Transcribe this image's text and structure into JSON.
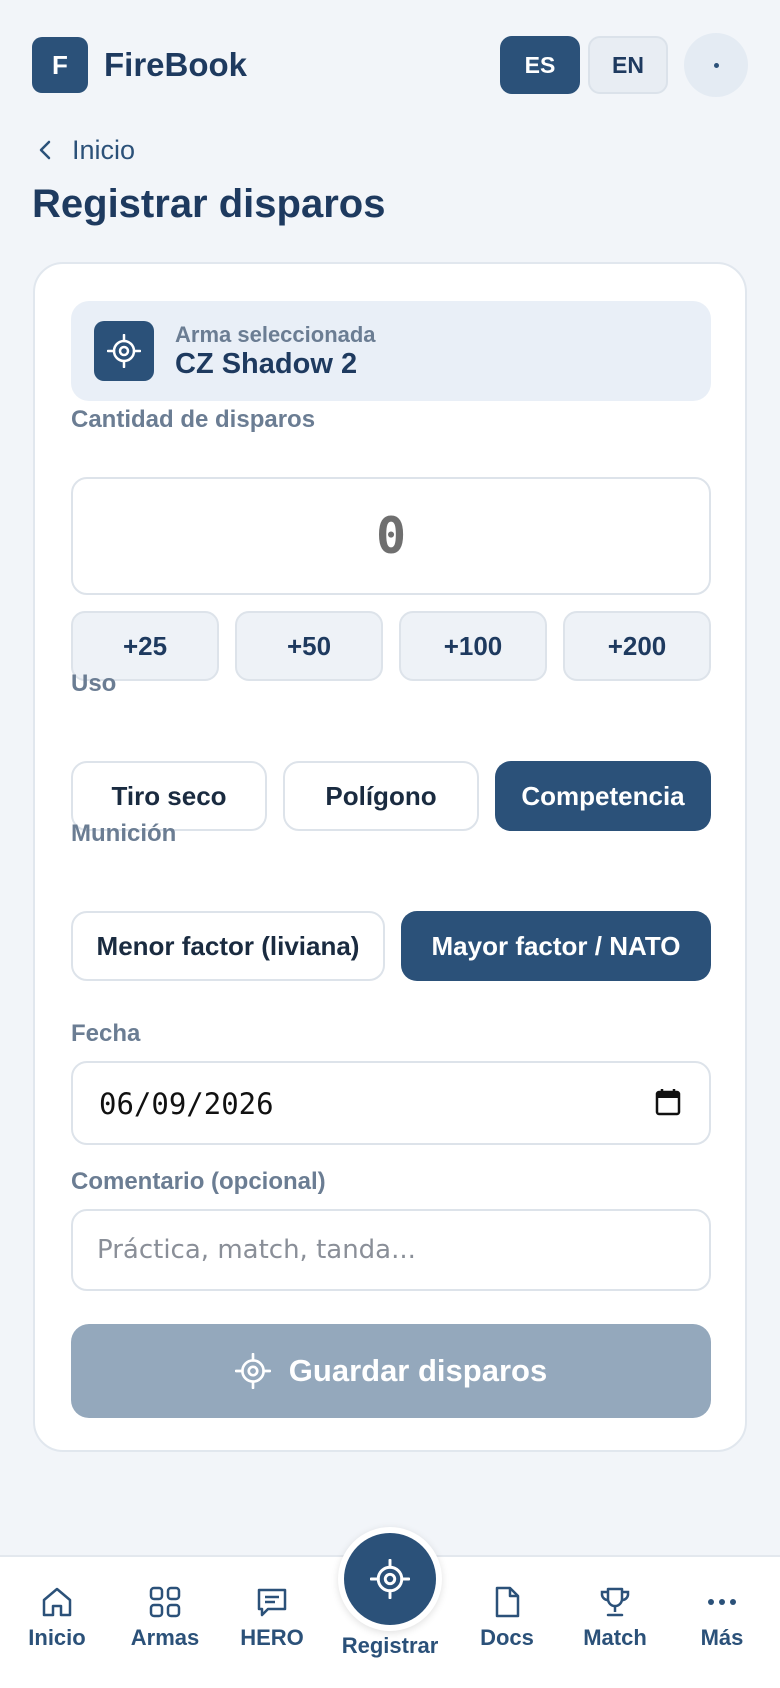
{
  "header": {
    "logo_letter": "F",
    "app_name": "FireBook",
    "lang_es": "ES",
    "lang_en": "EN"
  },
  "back_link": "Inicio",
  "page_title": "Registrar disparos",
  "weapon": {
    "label": "Arma seleccionada",
    "name": "CZ Shadow 2"
  },
  "quantity": {
    "label": "Cantidad de disparos",
    "value": "0",
    "quick_add": [
      "+25",
      "+50",
      "+100",
      "+200"
    ]
  },
  "use": {
    "label": "Uso",
    "options": [
      "Tiro seco",
      "Polígono",
      "Competencia"
    ],
    "selected": "Competencia"
  },
  "ammo": {
    "label": "Munición",
    "options": [
      "Menor factor (liviana)",
      "Mayor factor / NATO"
    ],
    "selected": "Mayor factor / NATO"
  },
  "date": {
    "label": "Fecha",
    "value": "06/09/2026"
  },
  "comment": {
    "label": "Comentario (opcional)",
    "placeholder": "Práctica, match, tanda..."
  },
  "save_label": "Guardar disparos",
  "nav": {
    "inicio": "Inicio",
    "armas": "Armas",
    "hero": "HERO",
    "registrar": "Registrar",
    "docs": "Docs",
    "match": "Match",
    "mas": "Más"
  },
  "colors": {
    "primary": "#2b5179",
    "disabled": "#94a8bc",
    "background": "#f2f5f9"
  }
}
